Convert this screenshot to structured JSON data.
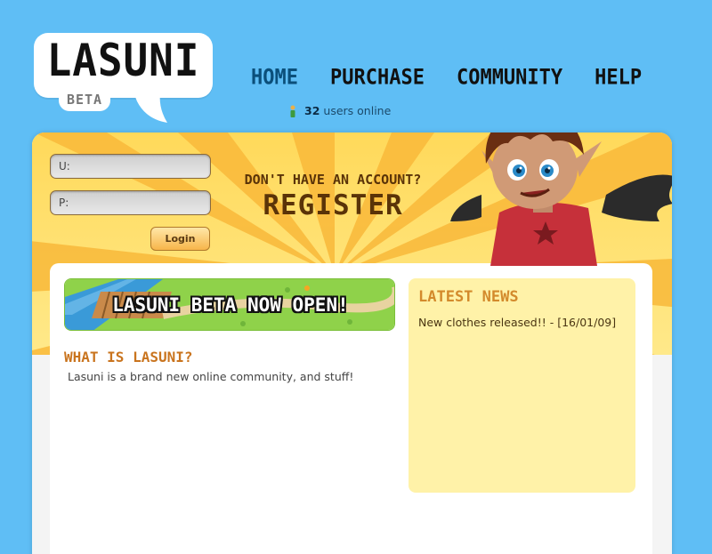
{
  "logo": {
    "text": "LASUNI",
    "badge": "BETA"
  },
  "nav": [
    {
      "label": "HOME",
      "active": true
    },
    {
      "label": "PURCHASE",
      "active": false
    },
    {
      "label": "COMMUNITY",
      "active": false
    },
    {
      "label": "HELP",
      "active": false
    }
  ],
  "online": {
    "count": "32",
    "label": "users online",
    "icon": "person-icon"
  },
  "login": {
    "username_placeholder": "U:",
    "password_placeholder": "P:",
    "button_label": "Login"
  },
  "signup": {
    "prompt": "DON'T HAVE AN ACCOUNT?",
    "register_label": "REGISTER"
  },
  "banner": {
    "text": "LASUNI BETA NOW OPEN!"
  },
  "about": {
    "heading": "WHAT IS LASUNI?",
    "body": "Lasuni is a brand new online community, and stuff!"
  },
  "news": {
    "heading": "LATEST NEWS",
    "items": [
      "New clothes released!! - [16/01/09]"
    ]
  },
  "colors": {
    "background": "#5fbef5",
    "news_box": "#fff2a8",
    "heading_orange": "#c9741e",
    "nav_active": "#0b4f7a"
  }
}
